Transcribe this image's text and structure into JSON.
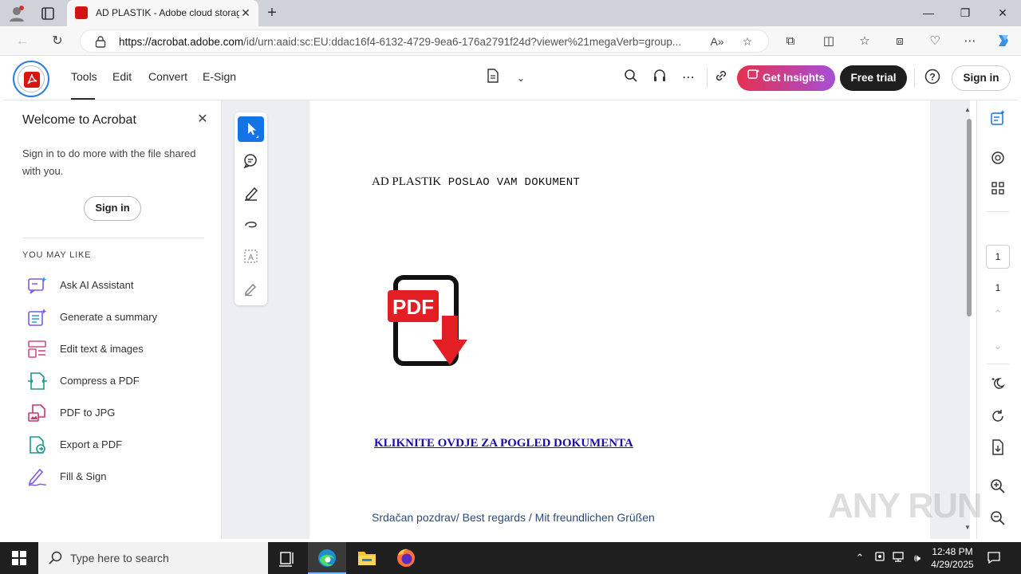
{
  "browser": {
    "tab_title": "AD PLASTIK - Adobe cloud storage",
    "url_host": "https://acrobat.adobe.com",
    "url_rest": "/id/urn:aaid:sc:EU:ddac16f4-6132-4729-9ea6-176a2791f24d?viewer%21megaVerb=group..."
  },
  "acrobat": {
    "menu": [
      "Tools",
      "Edit",
      "Convert",
      "E-Sign"
    ],
    "get_insights": "Get Insights",
    "free_trial": "Free trial",
    "sign_in": "Sign in"
  },
  "panel": {
    "title": "Welcome to Acrobat",
    "description": "Sign in to do more with the file shared with you.",
    "sign_in": "Sign in",
    "section_label": "YOU MAY LIKE",
    "items": [
      {
        "label": "Ask AI Assistant",
        "icon": "ai-assistant-icon"
      },
      {
        "label": "Generate a summary",
        "icon": "summary-icon"
      },
      {
        "label": "Edit text & images",
        "icon": "edit-text-icon"
      },
      {
        "label": "Compress a PDF",
        "icon": "compress-icon"
      },
      {
        "label": "PDF to JPG",
        "icon": "pdf-to-jpg-icon"
      },
      {
        "label": "Export a PDF",
        "icon": "export-pdf-icon"
      },
      {
        "label": "Fill & Sign",
        "icon": "fill-sign-icon"
      }
    ]
  },
  "document": {
    "heading_first": "AD PLASTIK",
    "heading_rest": " POSLAO VAM DOKUMENT",
    "pdf_badge": "PDF",
    "link_text": "KLIKNITE OVDJE ZA POGLED DOKUMENTA",
    "regards": "Srdačan pozdrav/ Best regards / Mit freundlichen Grüßen"
  },
  "pager": {
    "current": "1",
    "total": "1"
  },
  "watermark": "ANY RUN",
  "taskbar": {
    "search_placeholder": "Type here to search",
    "time": "12:48 PM",
    "date": "4/29/2025"
  },
  "colors": {
    "acrobat_red": "#d7170f",
    "accent_blue": "#1473e6",
    "link_blue": "#1a0dab",
    "insights_gradient_start": "#e5304f",
    "insights_gradient_end": "#a64fd7"
  }
}
